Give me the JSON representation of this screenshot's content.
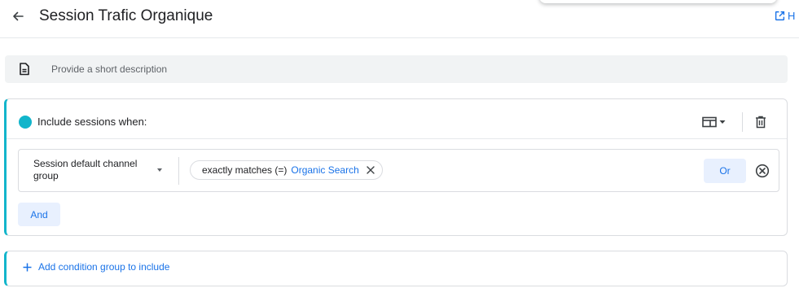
{
  "header": {
    "title": "Session Trafic Organique",
    "help_label": "H"
  },
  "description": {
    "placeholder": "Provide a short description",
    "value": ""
  },
  "include_group": {
    "title": "Include sessions when:",
    "accent_color": "#12b5cb",
    "condition": {
      "dimension_label": "Session default channel group",
      "operator": "exactly matches (=)",
      "value": "Organic Search",
      "or_label": "Or"
    },
    "and_label": "And"
  },
  "add_group": {
    "label": "Add condition group to include"
  },
  "icons": {
    "back": "arrow-left-icon",
    "help": "open-in-new-icon",
    "description": "document-icon",
    "scope": "scope-table-icon",
    "delete": "trash-icon",
    "chip_close": "close-icon",
    "remove": "circle-x-icon",
    "add": "plus-icon"
  },
  "colors": {
    "accent": "#1a73e8",
    "teal": "#12b5cb",
    "chip_bg": "#e8f0fe"
  }
}
